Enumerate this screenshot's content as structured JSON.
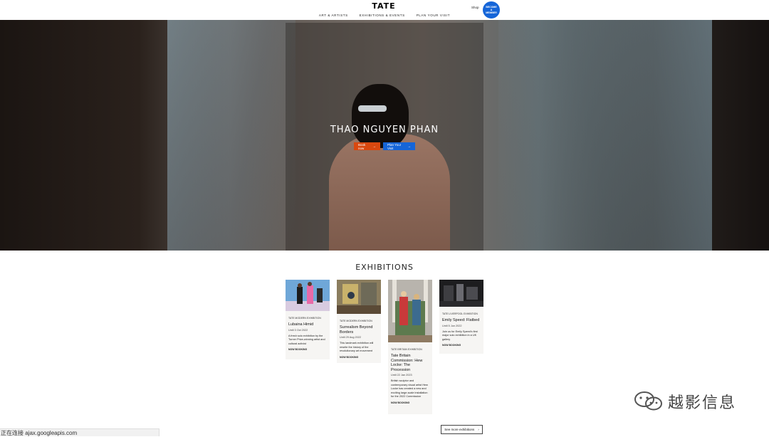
{
  "header": {
    "logo": "TATE",
    "nav": [
      "Art & Artists",
      "Exhibitions & Events",
      "Plan your visit"
    ],
    "shop": "Shop",
    "member_label": "Become a member",
    "colors": {
      "accent_blue": "#1565d8"
    }
  },
  "hero": {
    "title": "THAO NGUYEN PHAN",
    "book_label": "Book now",
    "plan_label": "Plan Your Visit",
    "colors": {
      "book": "#d9480f",
      "plan": "#1565d8"
    }
  },
  "exhibitions": {
    "title": "EXHIBITIONS",
    "see_more": "See more exhibitions",
    "cards": [
      {
        "venue": "Tate Modern Exhibition",
        "name": "Lubaina Himid",
        "dates": "Until 3 Oct 2022",
        "desc": "A fresh solo exhibition by the Turner Prize-winning artist and cultural activist",
        "cta": "Now Booking"
      },
      {
        "venue": "Tate Modern Exhibition",
        "name": "Surrealism Beyond Borders",
        "dates": "Until 29 Aug 2022",
        "desc": "This landmark exhibition will rewrite the history of the revolutionary art movement",
        "cta": "Now Booking"
      },
      {
        "venue": "Tate Britain Exhibition",
        "name": "Tate Britain Commission: Hew Locke: The Procession",
        "dates": "Until 22 Jan 2023",
        "desc": "British sculptor and contemporary visual artist Hew Locke has created a new and exciting large-scale installation for the 2022 Commission",
        "cta": "Now Booking"
      },
      {
        "venue": "Tate Liverpool Exhibition",
        "name": "Emily Speed: Flatbed",
        "dates": "Until 5 Jun 2022",
        "desc": "Join us for Emily Speed's first major solo exhibition in a UK gallery",
        "cta": "Now Booking"
      }
    ]
  },
  "status_bar": "正在连接 ajax.googleapis.com",
  "watermark": {
    "text": "越影信息",
    "icon": "wechat-icon"
  }
}
